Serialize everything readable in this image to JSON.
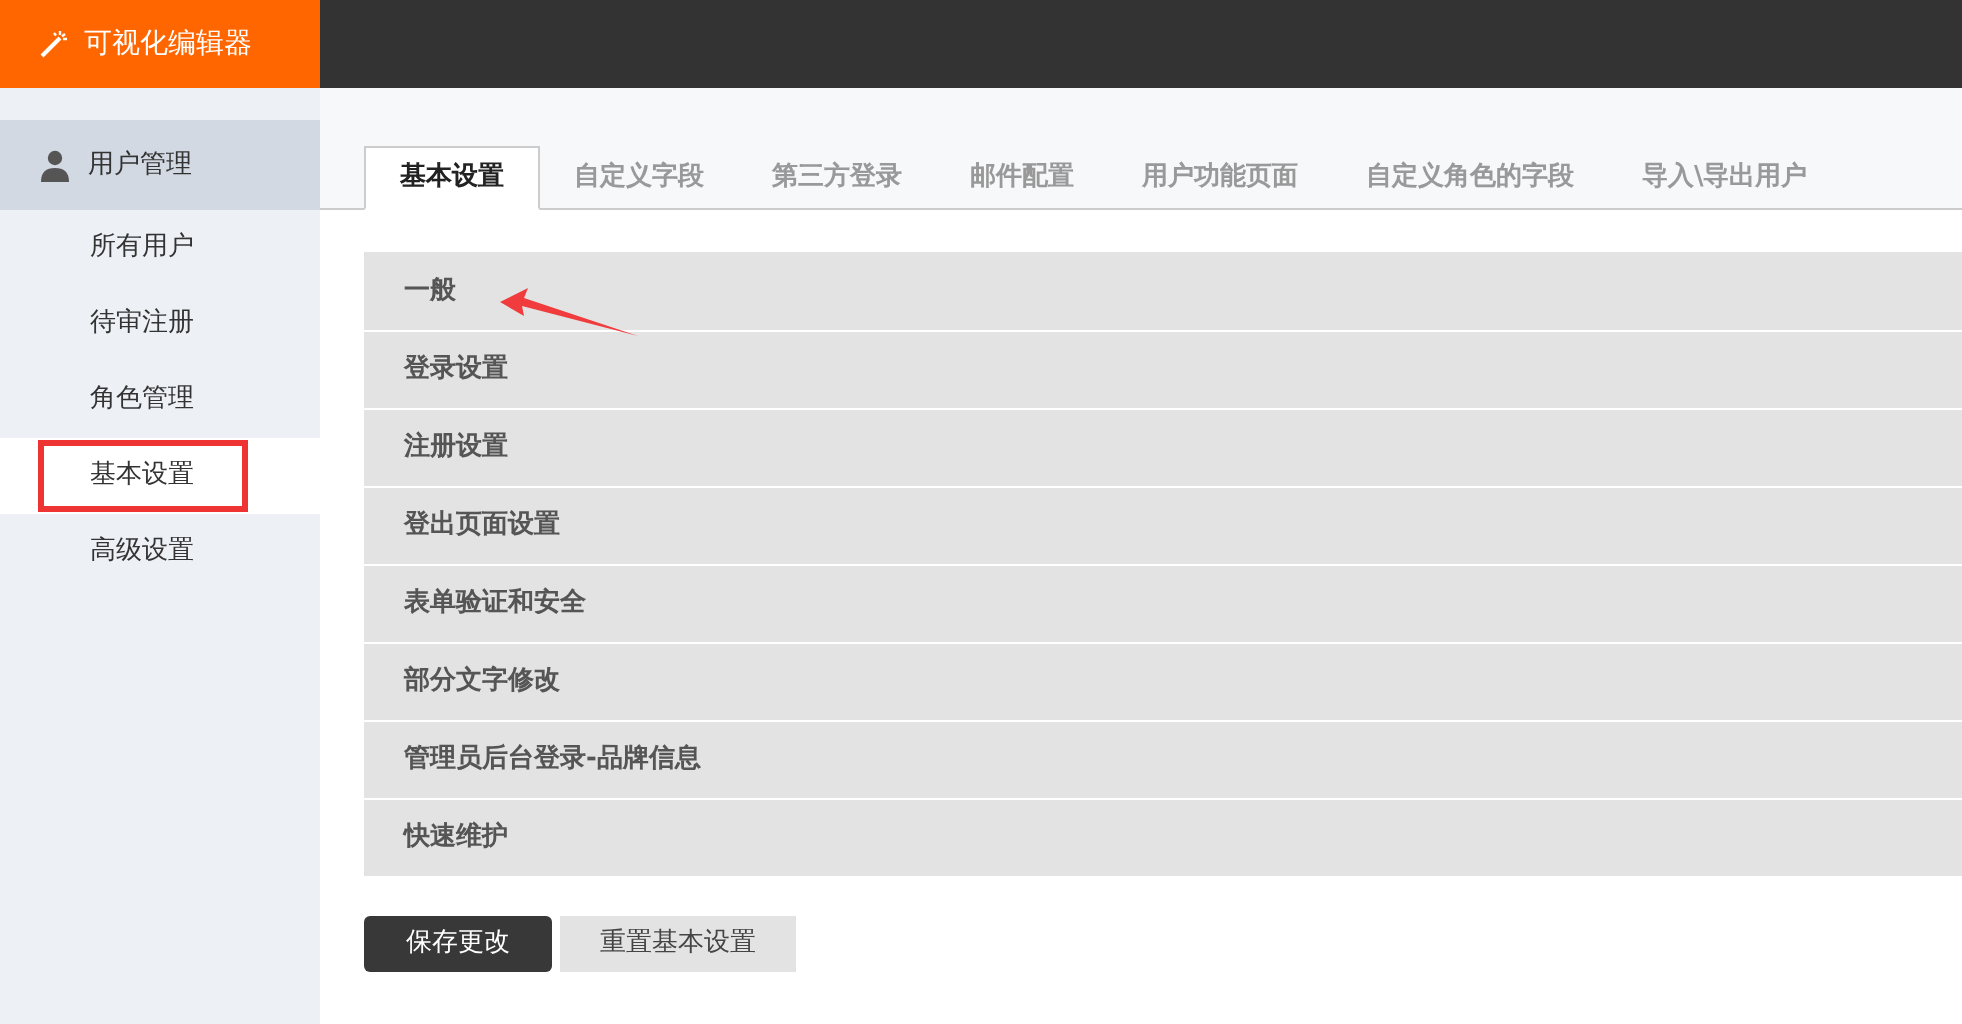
{
  "app": {
    "title": "可视化编辑器"
  },
  "sidebar": {
    "section": "用户管理",
    "items": [
      {
        "label": "所有用户",
        "selected": false
      },
      {
        "label": "待审注册",
        "selected": false
      },
      {
        "label": "角色管理",
        "selected": false
      },
      {
        "label": "基本设置",
        "selected": true
      },
      {
        "label": "高级设置",
        "selected": false
      }
    ]
  },
  "tabs": [
    {
      "label": "基本设置",
      "selected": true
    },
    {
      "label": "自定义字段",
      "selected": false
    },
    {
      "label": "第三方登录",
      "selected": false
    },
    {
      "label": "邮件配置",
      "selected": false
    },
    {
      "label": "用户功能页面",
      "selected": false
    },
    {
      "label": "自定义角色的字段",
      "selected": false
    },
    {
      "label": "导入\\导出用户",
      "selected": false
    }
  ],
  "sections": [
    {
      "label": "一般"
    },
    {
      "label": "登录设置"
    },
    {
      "label": "注册设置"
    },
    {
      "label": "登出页面设置"
    },
    {
      "label": "表单验证和安全"
    },
    {
      "label": "部分文字修改"
    },
    {
      "label": "管理员后台登录-品牌信息"
    },
    {
      "label": "快速维护"
    }
  ],
  "buttons": [
    {
      "label": "保存更改",
      "kind": "primary"
    },
    {
      "label": "重置基本设置",
      "kind": "secondary"
    }
  ]
}
